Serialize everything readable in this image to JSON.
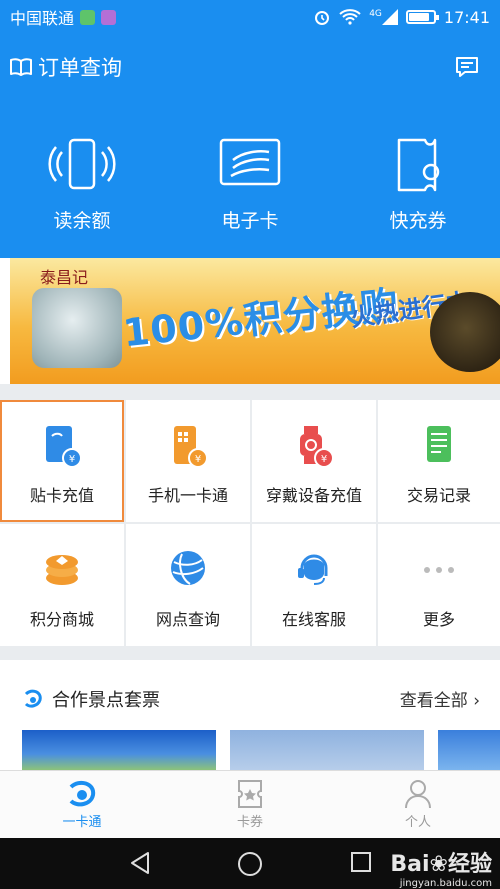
{
  "status": {
    "carrier": "中国联通",
    "network": "4G",
    "time": "17:41",
    "battery_level": 0.85
  },
  "header": {
    "order_query": "订单查询",
    "book_icon": "book-icon",
    "message_icon": "message-icon",
    "quick_actions": [
      {
        "label": "读余额",
        "icon": "phone-nfc-icon"
      },
      {
        "label": "电子卡",
        "icon": "ecard-icon"
      },
      {
        "label": "快充券",
        "icon": "ticket-icon"
      }
    ]
  },
  "banner": {
    "brand": "泰昌记",
    "headline": "100%积分换购",
    "subline": "火热进行中"
  },
  "grid": [
    {
      "label": "贴卡充值",
      "icon": "card-recharge-icon",
      "selected": true
    },
    {
      "label": "手机一卡通",
      "icon": "phone-card-icon"
    },
    {
      "label": "穿戴设备充值",
      "icon": "wearable-icon"
    },
    {
      "label": "交易记录",
      "icon": "record-icon"
    },
    {
      "label": "积分商城",
      "icon": "points-mall-icon"
    },
    {
      "label": "网点查询",
      "icon": "globe-icon"
    },
    {
      "label": "在线客服",
      "icon": "support-icon"
    },
    {
      "label": "更多",
      "icon": "more-icon"
    }
  ],
  "section": {
    "title": "合作景点套票",
    "more": "查看全部"
  },
  "tabs": [
    {
      "label": "一卡通",
      "icon": "yikatong-icon",
      "active": true
    },
    {
      "label": "卡券",
      "icon": "coupon-icon"
    },
    {
      "label": "个人",
      "icon": "person-icon"
    }
  ],
  "watermark": {
    "brand": "Bai",
    "brand2": "经验",
    "url": "jingyan.baidu.com"
  },
  "colors": {
    "primary": "#1a8ef0",
    "selected_outline": "#f08a3c",
    "page_bg": "#e9ecef"
  }
}
